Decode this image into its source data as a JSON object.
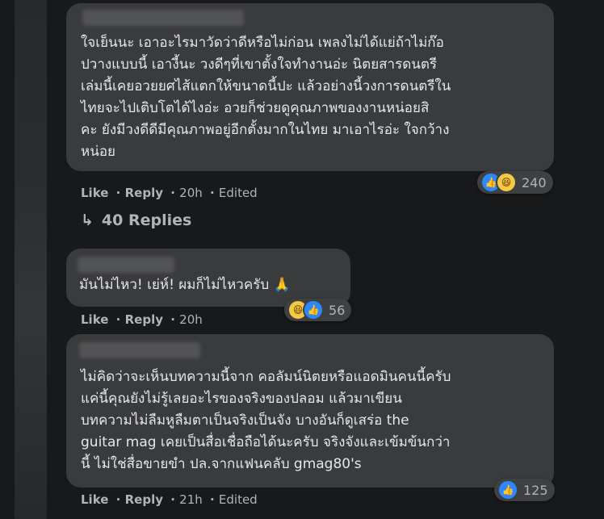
{
  "comments": [
    {
      "text": "ใจเย็นนะ เอาอะไรมาวัดว่าดีหรือไม่ก่อน เพลงไม่ได้แย่ถ้าไม่ก๊อ\nปวางแบบนี้ เอางี้นะ วงดีๆที่เขาตั้งใจทำงานอ่ะ นิตยสารดนตรี\nเล่มนี้เคยอวยยศไส้แตกให้ขนาดนี้ปะ แล้วอย่างนี้วงการดนตรีใน\nไทยจะไปเติบโตได้ไงอ่ะ อวยก็ช่วยดูคุณภาพของงานหน่อยสิ\nคะ ยังมีวงดีดีมีคุณภาพอยู่อีกตั้งมากในไทย มาเอาไรอ่ะ ใจกว้าง\nหน่อย",
      "like": "Like",
      "reply": "Reply",
      "time": "20h",
      "edited": "Edited",
      "reaction_count": "240",
      "reactions": [
        "like-icon",
        "haha-icon"
      ]
    },
    {
      "text": "มันไม่ไหว! เย่ห์! ผมก็ไม่ไหวครับ 🙏",
      "like": "Like",
      "reply": "Reply",
      "time": "20h",
      "edited": "",
      "reaction_count": "56",
      "reactions": [
        "haha-icon",
        "like-icon"
      ]
    },
    {
      "text": "ไม่คิดว่าจะเห็นบทความนี้จาก คอลัมน์นิตยหรือแอดมินคนนี้ครับ\nแค่นี้คุณยังไม่รู้เลยอะไรของจริงของปลอม แล้วมาเขียน\nบทความไม่ลืมหูลืมตาเป็นจริงเป็นจัง บางอันก็ดูเสร่อ the\nguitar mag เคยเป็นสื่อเชื่อถือได้นะครับ จริงจังและเข้มข้นกว่า\nนี้ ไม่ใช่สื่อขายขำ ปล.จากแฟนคลับ gmag80's",
      "like": "Like",
      "reply": "Reply",
      "time": "21h",
      "edited": "Edited",
      "reaction_count": "125",
      "reactions": [
        "like-icon"
      ]
    }
  ],
  "replies_link": "40 Replies",
  "colors": {
    "background": "#18191a",
    "bubble": "#3a3b3c",
    "like_blue": "#2d88ff",
    "haha_yellow": "#f7c843",
    "secondary_text": "#b0b3b8"
  }
}
